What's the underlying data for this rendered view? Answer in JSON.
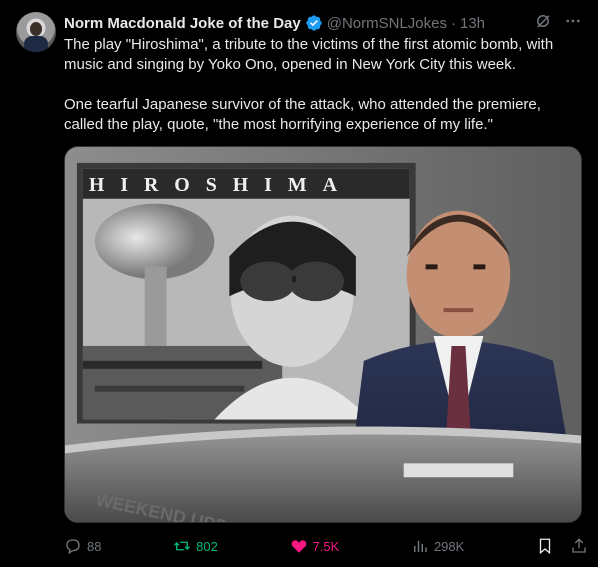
{
  "author": {
    "name": "Norm Macdonald Joke of the Day",
    "handle": "@NormSNLJokes",
    "separator": "·",
    "time": "13h",
    "verified": true,
    "avatar_icon": "avatar-photo"
  },
  "tweet": {
    "text": "The play \"Hiroshima\", a tribute to the victims of the first atomic bomb, with music and singing by Yoko Ono, opened in New York City this week.\n\nOne tearful Japanese survivor of the attack, who attended the premiere, called the play, quote, \"the most horrifying experience of my life.\""
  },
  "media": {
    "caption_graphic": "HIROSHIMA",
    "desk_text": "WEEKEND UPDATE"
  },
  "actions": {
    "replies": "88",
    "reposts": "802",
    "likes": "7.5K",
    "views": "298K"
  },
  "colors": {
    "background": "#000000",
    "text": "#e7e9ea",
    "secondary": "#71767b",
    "verified": "#1d9bf0",
    "repost": "#00ba7c",
    "like": "#f91880"
  },
  "icons": {
    "grok": "grok-icon",
    "more": "more-icon",
    "reply": "reply-icon",
    "repost": "repost-icon",
    "like": "heart-icon",
    "views": "views-icon",
    "bookmark": "bookmark-icon",
    "share": "share-icon"
  }
}
